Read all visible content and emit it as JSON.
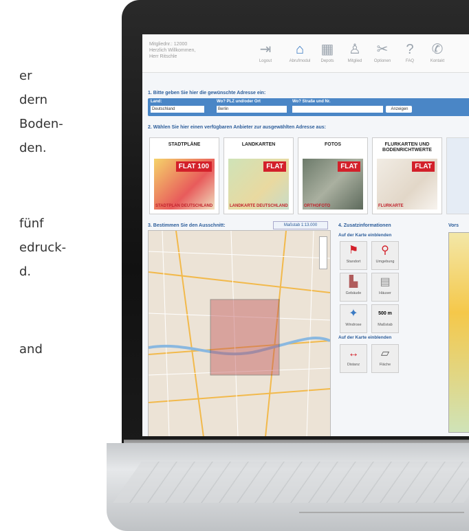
{
  "left_text": [
    "er",
    "dern",
    "Boden-",
    "den.",
    "fünf",
    "edruck-",
    "d.",
    "and"
  ],
  "header": {
    "member_lines": [
      "Mitgliednr.: 12000",
      "Herzlich Willkommen,",
      "Herr Ritschle"
    ],
    "nav": [
      {
        "label": "Logout",
        "icon": "logout-icon"
      },
      {
        "label": "Abrufmodul",
        "icon": "home-icon"
      },
      {
        "label": "Depots",
        "icon": "calendar-icon"
      },
      {
        "label": "Mitglied",
        "icon": "user-icon"
      },
      {
        "label": "Optionen",
        "icon": "tools-icon"
      },
      {
        "label": "FAQ",
        "icon": "help-icon"
      },
      {
        "label": "Kontakt",
        "icon": "phone-icon"
      }
    ]
  },
  "step1": {
    "title": "1. Bitte geben Sie hier die gewünschte Adresse ein:",
    "land_label": "Land:",
    "land_value": "Deutschland",
    "ort_label": "Wo? PLZ und/oder Ort",
    "ort_value": "Berlin",
    "str_label": "Wo? Straße und Nr.",
    "str_value": "",
    "button": "Anzeigen"
  },
  "step2": {
    "title": "2. Wählen Sie hier einen verfügbaren Anbieter zur ausgewählten Adresse aus:",
    "tiles": [
      {
        "title": "STADTPLÄNE",
        "caption": "STADTPLAN DEUTSCHLAND",
        "badge": "FLAT 100"
      },
      {
        "title": "LANDKARTEN",
        "caption": "LANDKARTE DEUTSCHLAND",
        "badge": "FLAT"
      },
      {
        "title": "FOTOS",
        "caption": "ORTHOFOTO",
        "badge": "FLAT"
      },
      {
        "title": "FLURKARTEN UND BODENRICHTWERTE",
        "caption": "FLURKARTE",
        "badge": "FLAT"
      }
    ]
  },
  "step3": {
    "title": "3. Bestimmen Sie den Ausschnitt:",
    "scale": "Maßstab 1:13.000"
  },
  "step4": {
    "title": "4. Zusatzinformationen",
    "group1": "Auf der Karte einblenden",
    "group2": "Auf der Karte einblenden",
    "buttons": [
      {
        "label": "Standort",
        "icon": "flag-icon"
      },
      {
        "label": "Umgebung",
        "icon": "pins-icon"
      },
      {
        "label": "Gebäude",
        "icon": "building-icon"
      },
      {
        "label": "Häuser",
        "icon": "houses-icon"
      },
      {
        "label": "Windrose",
        "icon": "compass-icon"
      },
      {
        "label": "Maßstab",
        "icon": "scale-icon"
      },
      {
        "label": "Distanz",
        "icon": "distance-icon"
      },
      {
        "label": "Fläche",
        "icon": "area-icon"
      }
    ],
    "scale_badge": "500 m"
  },
  "vorschau_label": "Vors"
}
